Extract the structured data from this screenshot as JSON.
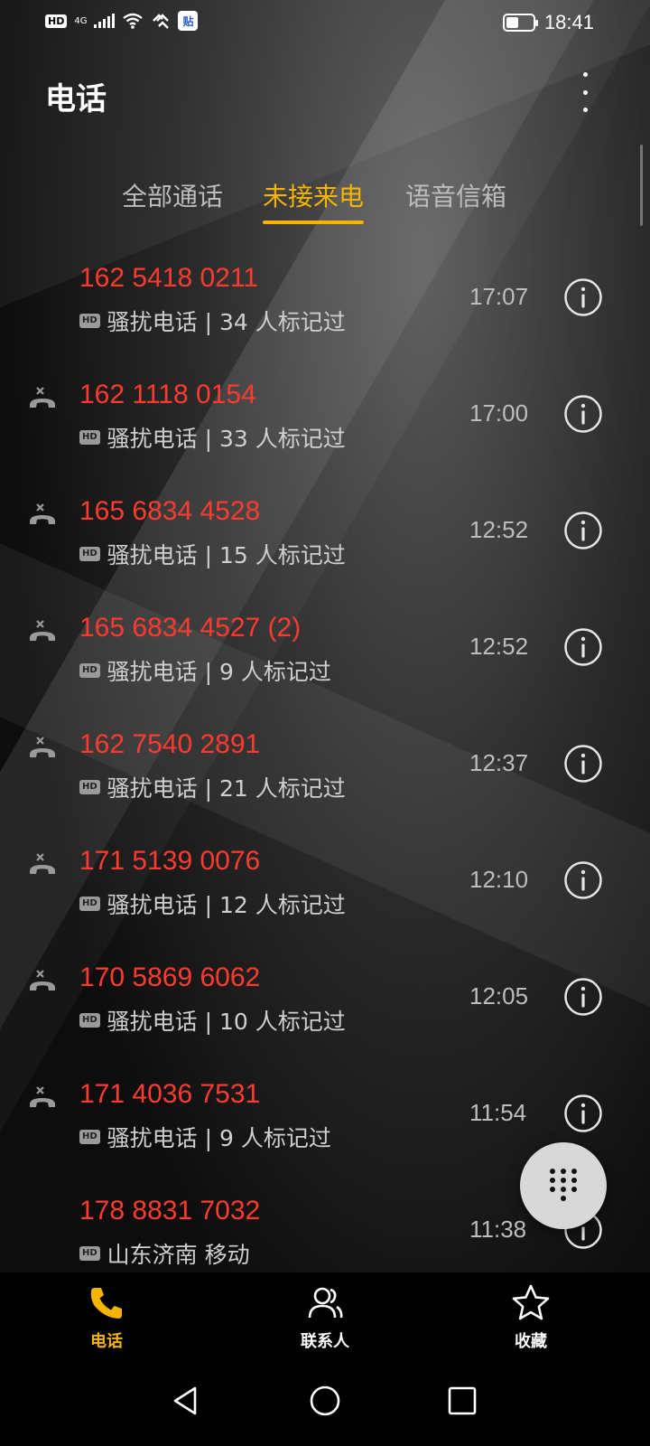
{
  "status_bar": {
    "hd": "HD",
    "network": "4G",
    "badge": "贴",
    "time": "18:41",
    "battery_level": 0.45
  },
  "app_bar": {
    "title": "电话",
    "menu_icon": "more-vertical-icon"
  },
  "tabs": [
    {
      "label": "全部通话",
      "active": false
    },
    {
      "label": "未接来电",
      "active": true
    },
    {
      "label": "语音信箱",
      "active": false
    }
  ],
  "calls": [
    {
      "number": "162 5418 0211",
      "badge": "HD",
      "desc": "骚扰电话 | 34 人标记过",
      "time": "17:07",
      "missed_icon": false
    },
    {
      "number": "162 1118 0154",
      "badge": "HD",
      "desc": "骚扰电话 | 33 人标记过",
      "time": "17:00",
      "missed_icon": true
    },
    {
      "number": "165 6834 4528",
      "badge": "HD",
      "desc": "骚扰电话 | 15 人标记过",
      "time": "12:52",
      "missed_icon": true
    },
    {
      "number": "165 6834 4527 (2)",
      "badge": "HD",
      "desc": "骚扰电话 | 9 人标记过",
      "time": "12:52",
      "missed_icon": true
    },
    {
      "number": "162 7540 2891",
      "badge": "HD",
      "desc": "骚扰电话 | 21 人标记过",
      "time": "12:37",
      "missed_icon": true
    },
    {
      "number": "171 5139 0076",
      "badge": "HD",
      "desc": "骚扰电话 | 12 人标记过",
      "time": "12:10",
      "missed_icon": true
    },
    {
      "number": "170 5869 6062",
      "badge": "HD",
      "desc": "骚扰电话 | 10 人标记过",
      "time": "12:05",
      "missed_icon": true
    },
    {
      "number": "171 4036 7531",
      "badge": "HD",
      "desc": "骚扰电话 | 9 人标记过",
      "time": "11:54",
      "missed_icon": true
    },
    {
      "number": "178 8831 7032",
      "badge": "HD",
      "desc": "山东济南 移动",
      "time": "11:38",
      "missed_icon": false
    }
  ],
  "fab": {
    "icon": "dialpad-icon"
  },
  "bottom_nav": [
    {
      "label": "电话",
      "icon": "phone-icon",
      "active": true
    },
    {
      "label": "联系人",
      "icon": "contacts-icon",
      "active": false
    },
    {
      "label": "收藏",
      "icon": "star-icon",
      "active": false
    }
  ],
  "system_nav": [
    "back-icon",
    "home-icon",
    "recents-icon"
  ],
  "colors": {
    "accent": "#f5b400",
    "missed_red": "#ff3b30",
    "background": "#111111"
  }
}
